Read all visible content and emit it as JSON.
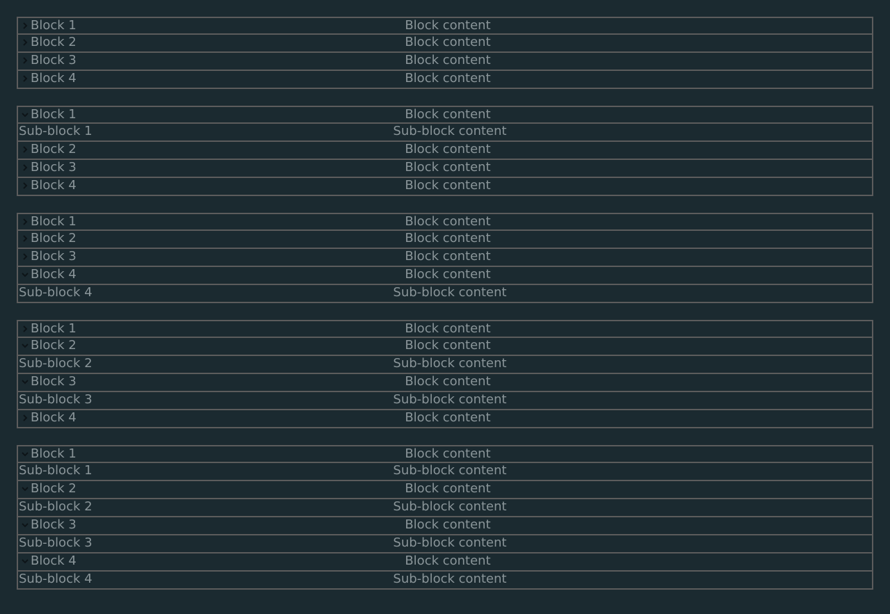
{
  "colors": {
    "background": "#1b2a30",
    "border": "#5c5c5c",
    "text": "#8a9599",
    "chevron": "#0d1418"
  },
  "groups": [
    {
      "rows": [
        {
          "type": "block",
          "expanded": false,
          "label": "Block 1",
          "content": "Block content"
        },
        {
          "type": "block",
          "expanded": false,
          "label": "Block 2",
          "content": "Block content"
        },
        {
          "type": "block",
          "expanded": false,
          "label": "Block 3",
          "content": "Block content"
        },
        {
          "type": "block",
          "expanded": false,
          "label": "Block 4",
          "content": "Block content"
        }
      ]
    },
    {
      "rows": [
        {
          "type": "block",
          "expanded": true,
          "label": "Block 1",
          "content": "Block content"
        },
        {
          "type": "sub",
          "label": "Sub-block 1",
          "content": "Sub-block content"
        },
        {
          "type": "block",
          "expanded": false,
          "label": "Block 2",
          "content": "Block content"
        },
        {
          "type": "block",
          "expanded": false,
          "label": "Block 3",
          "content": "Block content"
        },
        {
          "type": "block",
          "expanded": false,
          "label": "Block 4",
          "content": "Block content"
        }
      ]
    },
    {
      "rows": [
        {
          "type": "block",
          "expanded": false,
          "label": "Block 1",
          "content": "Block content"
        },
        {
          "type": "block",
          "expanded": false,
          "label": "Block 2",
          "content": "Block content"
        },
        {
          "type": "block",
          "expanded": false,
          "label": "Block 3",
          "content": "Block content"
        },
        {
          "type": "block",
          "expanded": true,
          "label": "Block 4",
          "content": "Block content"
        },
        {
          "type": "sub",
          "label": "Sub-block 4",
          "content": "Sub-block content"
        }
      ]
    },
    {
      "rows": [
        {
          "type": "block",
          "expanded": false,
          "label": "Block 1",
          "content": "Block content"
        },
        {
          "type": "block",
          "expanded": true,
          "label": "Block 2",
          "content": "Block content"
        },
        {
          "type": "sub",
          "label": "Sub-block 2",
          "content": "Sub-block content"
        },
        {
          "type": "block",
          "expanded": true,
          "label": "Block 3",
          "content": "Block content"
        },
        {
          "type": "sub",
          "label": "Sub-block 3",
          "content": "Sub-block content"
        },
        {
          "type": "block",
          "expanded": false,
          "label": "Block 4",
          "content": "Block content"
        }
      ]
    },
    {
      "rows": [
        {
          "type": "block",
          "expanded": true,
          "label": "Block 1",
          "content": "Block content"
        },
        {
          "type": "sub",
          "label": "Sub-block 1",
          "content": "Sub-block content"
        },
        {
          "type": "block",
          "expanded": true,
          "label": "Block 2",
          "content": "Block content"
        },
        {
          "type": "sub",
          "label": "Sub-block 2",
          "content": "Sub-block content"
        },
        {
          "type": "block",
          "expanded": true,
          "label": "Block 3",
          "content": "Block content"
        },
        {
          "type": "sub",
          "label": "Sub-block 3",
          "content": "Sub-block content"
        },
        {
          "type": "block",
          "expanded": true,
          "label": "Block 4",
          "content": "Block content"
        },
        {
          "type": "sub",
          "label": "Sub-block 4",
          "content": "Sub-block content"
        }
      ]
    }
  ]
}
